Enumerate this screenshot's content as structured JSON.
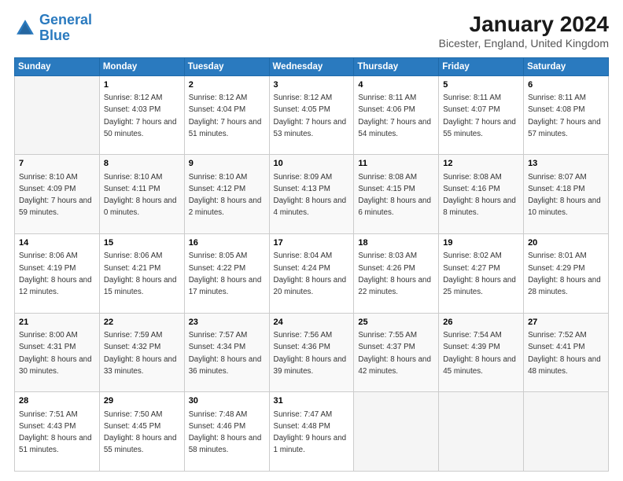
{
  "logo": {
    "line1": "General",
    "line2": "Blue"
  },
  "title": "January 2024",
  "subtitle": "Bicester, England, United Kingdom",
  "days_header": [
    "Sunday",
    "Monday",
    "Tuesday",
    "Wednesday",
    "Thursday",
    "Friday",
    "Saturday"
  ],
  "weeks": [
    [
      {
        "num": "",
        "sunrise": "",
        "sunset": "",
        "daylight": "",
        "empty": true
      },
      {
        "num": "1",
        "sunrise": "8:12 AM",
        "sunset": "4:03 PM",
        "daylight": "7 hours and 50 minutes."
      },
      {
        "num": "2",
        "sunrise": "8:12 AM",
        "sunset": "4:04 PM",
        "daylight": "7 hours and 51 minutes."
      },
      {
        "num": "3",
        "sunrise": "8:12 AM",
        "sunset": "4:05 PM",
        "daylight": "7 hours and 53 minutes."
      },
      {
        "num": "4",
        "sunrise": "8:11 AM",
        "sunset": "4:06 PM",
        "daylight": "7 hours and 54 minutes."
      },
      {
        "num": "5",
        "sunrise": "8:11 AM",
        "sunset": "4:07 PM",
        "daylight": "7 hours and 55 minutes."
      },
      {
        "num": "6",
        "sunrise": "8:11 AM",
        "sunset": "4:08 PM",
        "daylight": "7 hours and 57 minutes."
      }
    ],
    [
      {
        "num": "7",
        "sunrise": "8:10 AM",
        "sunset": "4:09 PM",
        "daylight": "7 hours and 59 minutes."
      },
      {
        "num": "8",
        "sunrise": "8:10 AM",
        "sunset": "4:11 PM",
        "daylight": "8 hours and 0 minutes."
      },
      {
        "num": "9",
        "sunrise": "8:10 AM",
        "sunset": "4:12 PM",
        "daylight": "8 hours and 2 minutes."
      },
      {
        "num": "10",
        "sunrise": "8:09 AM",
        "sunset": "4:13 PM",
        "daylight": "8 hours and 4 minutes."
      },
      {
        "num": "11",
        "sunrise": "8:08 AM",
        "sunset": "4:15 PM",
        "daylight": "8 hours and 6 minutes."
      },
      {
        "num": "12",
        "sunrise": "8:08 AM",
        "sunset": "4:16 PM",
        "daylight": "8 hours and 8 minutes."
      },
      {
        "num": "13",
        "sunrise": "8:07 AM",
        "sunset": "4:18 PM",
        "daylight": "8 hours and 10 minutes."
      }
    ],
    [
      {
        "num": "14",
        "sunrise": "8:06 AM",
        "sunset": "4:19 PM",
        "daylight": "8 hours and 12 minutes."
      },
      {
        "num": "15",
        "sunrise": "8:06 AM",
        "sunset": "4:21 PM",
        "daylight": "8 hours and 15 minutes."
      },
      {
        "num": "16",
        "sunrise": "8:05 AM",
        "sunset": "4:22 PM",
        "daylight": "8 hours and 17 minutes."
      },
      {
        "num": "17",
        "sunrise": "8:04 AM",
        "sunset": "4:24 PM",
        "daylight": "8 hours and 20 minutes."
      },
      {
        "num": "18",
        "sunrise": "8:03 AM",
        "sunset": "4:26 PM",
        "daylight": "8 hours and 22 minutes."
      },
      {
        "num": "19",
        "sunrise": "8:02 AM",
        "sunset": "4:27 PM",
        "daylight": "8 hours and 25 minutes."
      },
      {
        "num": "20",
        "sunrise": "8:01 AM",
        "sunset": "4:29 PM",
        "daylight": "8 hours and 28 minutes."
      }
    ],
    [
      {
        "num": "21",
        "sunrise": "8:00 AM",
        "sunset": "4:31 PM",
        "daylight": "8 hours and 30 minutes."
      },
      {
        "num": "22",
        "sunrise": "7:59 AM",
        "sunset": "4:32 PM",
        "daylight": "8 hours and 33 minutes."
      },
      {
        "num": "23",
        "sunrise": "7:57 AM",
        "sunset": "4:34 PM",
        "daylight": "8 hours and 36 minutes."
      },
      {
        "num": "24",
        "sunrise": "7:56 AM",
        "sunset": "4:36 PM",
        "daylight": "8 hours and 39 minutes."
      },
      {
        "num": "25",
        "sunrise": "7:55 AM",
        "sunset": "4:37 PM",
        "daylight": "8 hours and 42 minutes."
      },
      {
        "num": "26",
        "sunrise": "7:54 AM",
        "sunset": "4:39 PM",
        "daylight": "8 hours and 45 minutes."
      },
      {
        "num": "27",
        "sunrise": "7:52 AM",
        "sunset": "4:41 PM",
        "daylight": "8 hours and 48 minutes."
      }
    ],
    [
      {
        "num": "28",
        "sunrise": "7:51 AM",
        "sunset": "4:43 PM",
        "daylight": "8 hours and 51 minutes."
      },
      {
        "num": "29",
        "sunrise": "7:50 AM",
        "sunset": "4:45 PM",
        "daylight": "8 hours and 55 minutes."
      },
      {
        "num": "30",
        "sunrise": "7:48 AM",
        "sunset": "4:46 PM",
        "daylight": "8 hours and 58 minutes."
      },
      {
        "num": "31",
        "sunrise": "7:47 AM",
        "sunset": "4:48 PM",
        "daylight": "9 hours and 1 minute."
      },
      {
        "num": "",
        "sunrise": "",
        "sunset": "",
        "daylight": "",
        "empty": true
      },
      {
        "num": "",
        "sunrise": "",
        "sunset": "",
        "daylight": "",
        "empty": true
      },
      {
        "num": "",
        "sunrise": "",
        "sunset": "",
        "daylight": "",
        "empty": true
      }
    ]
  ]
}
